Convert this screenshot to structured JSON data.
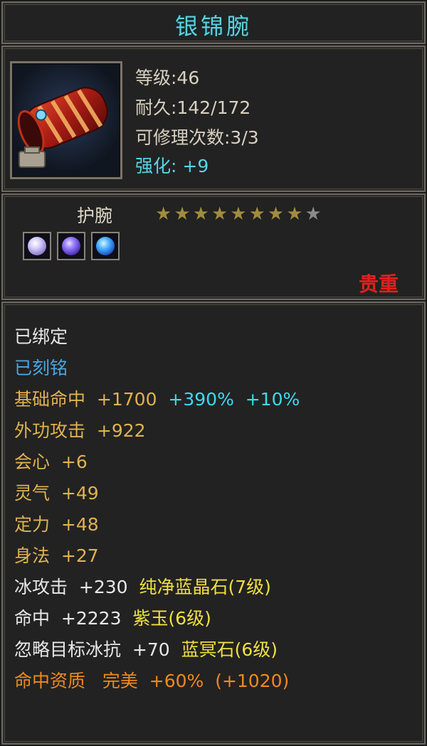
{
  "item": {
    "name": "银锦腕",
    "level_text": "等级:46",
    "durability_text": "耐久:142/172",
    "repair_text": "可修理次数:3/3",
    "enhance_label": "强化:",
    "enhance_value": "+9",
    "type": "护腕",
    "stars_filled": 8,
    "stars_total": 9,
    "rarity": "贵重",
    "icon": "red-bracer-icon",
    "gem_sockets": [
      "white-crystal-gem-icon",
      "purple-jade-gem-icon",
      "blue-crystal-gem-icon"
    ]
  },
  "attributes": {
    "bound": "已绑定",
    "engraved": "已刻铭",
    "hit_base": {
      "label": "基础命中",
      "value": "+1700",
      "bonus1": "+390%",
      "bonus2": "+10%"
    },
    "ext_attack": {
      "label": "外功攻击",
      "value": "+922"
    },
    "crit": {
      "label": "会心",
      "value": "+6"
    },
    "spirit": {
      "label": "灵气",
      "value": "+49"
    },
    "focus": {
      "label": "定力",
      "value": "+48"
    },
    "agility": {
      "label": "身法",
      "value": "+27"
    },
    "ice_attack": {
      "label": "冰攻击",
      "value": "+230",
      "gem": "纯净蓝晶石(7级)"
    },
    "hit": {
      "label": "命中",
      "value": "+2223",
      "gem": "紫玉(6级)"
    },
    "ignore_ice": {
      "label": "忽略目标冰抗",
      "value": "+70",
      "gem": "蓝冥石(6级)"
    },
    "aptitude": {
      "label": "命中资质",
      "grade": "完美",
      "pct": "+60%",
      "extra": "(+1020)"
    }
  },
  "colors": {
    "title": "#5fd0dc",
    "rarity": "#e02020",
    "base": "#e0b250",
    "gem": "#f0e040",
    "aptitude": "#f08a1c",
    "engraved": "#4aa6e0"
  }
}
